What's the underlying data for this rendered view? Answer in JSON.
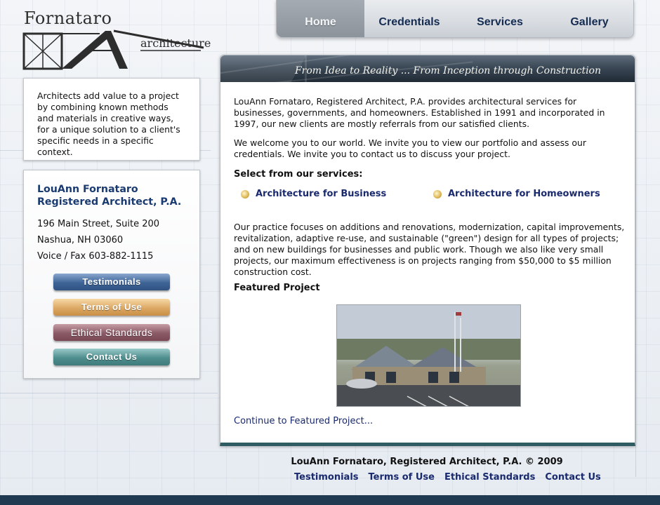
{
  "logo": {
    "name": "Fornataro",
    "sub": "architecture"
  },
  "nav": {
    "tabs": [
      {
        "label": "Home"
      },
      {
        "label": "Credentials"
      },
      {
        "label": "Services"
      },
      {
        "label": "Gallery"
      }
    ]
  },
  "intro": {
    "text": "Architects add value to a project by combining known methods and materials in creative ways, for a unique solution to a client's specific needs in a specific context."
  },
  "contact": {
    "name_line1": "LouAnn Fornataro",
    "name_line2": "Registered Architect, P.A.",
    "address1": "196 Main Street, Suite 200",
    "address2": "Nashua, NH 03060",
    "phone": "Voice / Fax 603-882-1115",
    "buttons": {
      "testimonials": "Testimonials",
      "terms": "Terms of Use",
      "ethics": "Ethical Standards",
      "contact": "Contact Us"
    }
  },
  "banner": {
    "tagline": "From Idea to Reality ... From Inception through Construction"
  },
  "main": {
    "para1": "LouAnn Fornataro, Registered Architect, P.A. provides architectural services for businesses, governments, and homeowners. Established in 1991 and incorporated in 1997, our new clients are mostly referrals from our satisfied clients.",
    "para2": "We welcome you to our world. We invite you to view our portfolio and assess our credentials. We invite you to contact us to discuss your project.",
    "services_heading": "Select from our services:",
    "service_business": "Architecture for Business",
    "service_homeowners": "Architecture for Homeowners",
    "para3": "Our practice focuses on additions and renovations, modernization, capital improvements, revitalization, adaptive re-use, and sustainable (\"green\") design for all types of projects; and on new buildings for businesses and public work. Though we also like very small projects, our maximum effectiveness is on projects ranging from $50,000 to $5 million construction cost.",
    "featured_heading": "Featured Project",
    "continue_link": "Continue to Featured Project..."
  },
  "footer": {
    "copyright": "LouAnn Fornataro, Registered Architect, P.A. © 2009",
    "links": [
      "Testimonials",
      "Terms of Use",
      "Ethical Standards",
      "Contact Us"
    ]
  },
  "colors": {
    "link": "#1a2a6e",
    "firm_name": "#1a3a72",
    "bottom_band": "#203a52",
    "panel_bottom": "#2f5c63"
  }
}
